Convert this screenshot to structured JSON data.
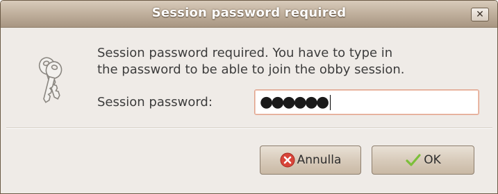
{
  "window": {
    "title": "Session password required"
  },
  "dialog": {
    "icon": "keys-icon",
    "message_line1": "Session password required. You have to type in",
    "message_line2": "the password to be able to join the obby session.",
    "password_label": "Session password:",
    "password_mask": "●●●●●●",
    "password_length": 6
  },
  "buttons": {
    "cancel_label": "Annulla",
    "cancel_icon": "cancel-icon",
    "ok_label": "OK",
    "ok_icon": "checkmark-icon"
  },
  "colors": {
    "titlebar": "#c2b29f",
    "window_bg": "#efebe7",
    "input_focus_border": "#e0a08a",
    "cancel_icon": "#d8453a",
    "ok_icon": "#7cbf3a"
  }
}
